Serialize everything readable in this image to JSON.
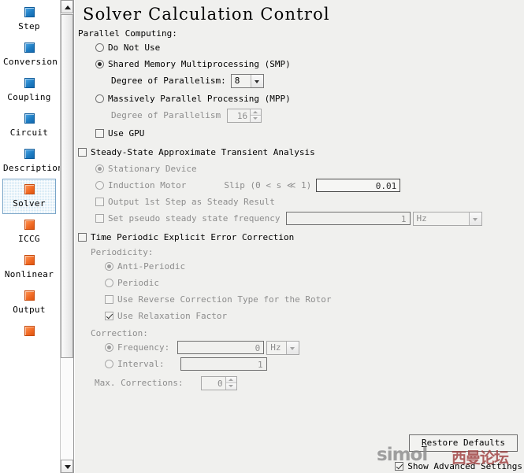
{
  "sidebar": {
    "items": [
      {
        "label": "Step",
        "icon": "blue-square-icon",
        "color": "blue",
        "selected": false
      },
      {
        "label": "Conversion",
        "icon": "blue-square-icon",
        "color": "blue",
        "selected": false
      },
      {
        "label": "Coupling",
        "icon": "blue-square-icon",
        "color": "blue",
        "selected": false
      },
      {
        "label": "Circuit",
        "icon": "blue-square-icon",
        "color": "blue",
        "selected": false
      },
      {
        "label": "Description",
        "icon": "blue-square-icon",
        "color": "blue",
        "selected": false
      },
      {
        "label": "Solver",
        "icon": "orange-square-icon",
        "color": "orange",
        "selected": true
      },
      {
        "label": "ICCG",
        "icon": "orange-square-icon",
        "color": "orange",
        "selected": false
      },
      {
        "label": "Nonlinear",
        "icon": "orange-square-icon",
        "color": "orange",
        "selected": false
      },
      {
        "label": "Output",
        "icon": "orange-square-icon",
        "color": "orange",
        "selected": false
      }
    ],
    "scroll_up_icon": "scroll-up-arrow-icon",
    "scroll_down_icon": "scroll-down-arrow-icon"
  },
  "page": {
    "title": "Solver Calculation Control"
  },
  "parallel": {
    "group_label": "Parallel Computing:",
    "do_not_use": "Do Not Use",
    "smp": "Shared Memory Multiprocessing (SMP)",
    "smp_degree_label": "Degree of Parallelism:",
    "smp_degree_value": "8",
    "mpp": "Massively Parallel Processing (MPP)",
    "mpp_degree_label": "Degree of Parallelism",
    "mpp_degree_value": "16",
    "use_gpu": "Use GPU"
  },
  "steady": {
    "title": "Steady-State Approximate Transient Analysis",
    "stationary_device": "Stationary Device",
    "induction_motor": "Induction Motor",
    "slip_label": "Slip (0 < s ≪ 1)",
    "slip_value": "0.01",
    "output_first_step": "Output 1st Step as Steady Result",
    "pseudo_label": "Set pseudo steady state frequency",
    "pseudo_value": "1",
    "pseudo_unit": "Hz"
  },
  "periodic": {
    "title": "Time Periodic Explicit Error Correction",
    "periodicity_label": "Periodicity:",
    "anti_periodic": "Anti-Periodic",
    "periodic": "Periodic",
    "reverse_correction": "Use Reverse Correction Type for the Rotor",
    "relaxation_factor": "Use Relaxation Factor",
    "correction_label": "Correction:",
    "frequency_label": "Frequency:",
    "frequency_value": "0",
    "frequency_unit": "Hz",
    "interval_label": "Interval:",
    "interval_value": "1",
    "max_corrections_label": "Max. Corrections:",
    "max_corrections_value": "0"
  },
  "footer": {
    "restore_defaults_mnemonic": "R",
    "restore_defaults_rest": "estore Defaults",
    "show_advanced": "Show Advanced Settings"
  },
  "watermark": {
    "latin": "simol",
    "cjk": "西曼论坛"
  }
}
